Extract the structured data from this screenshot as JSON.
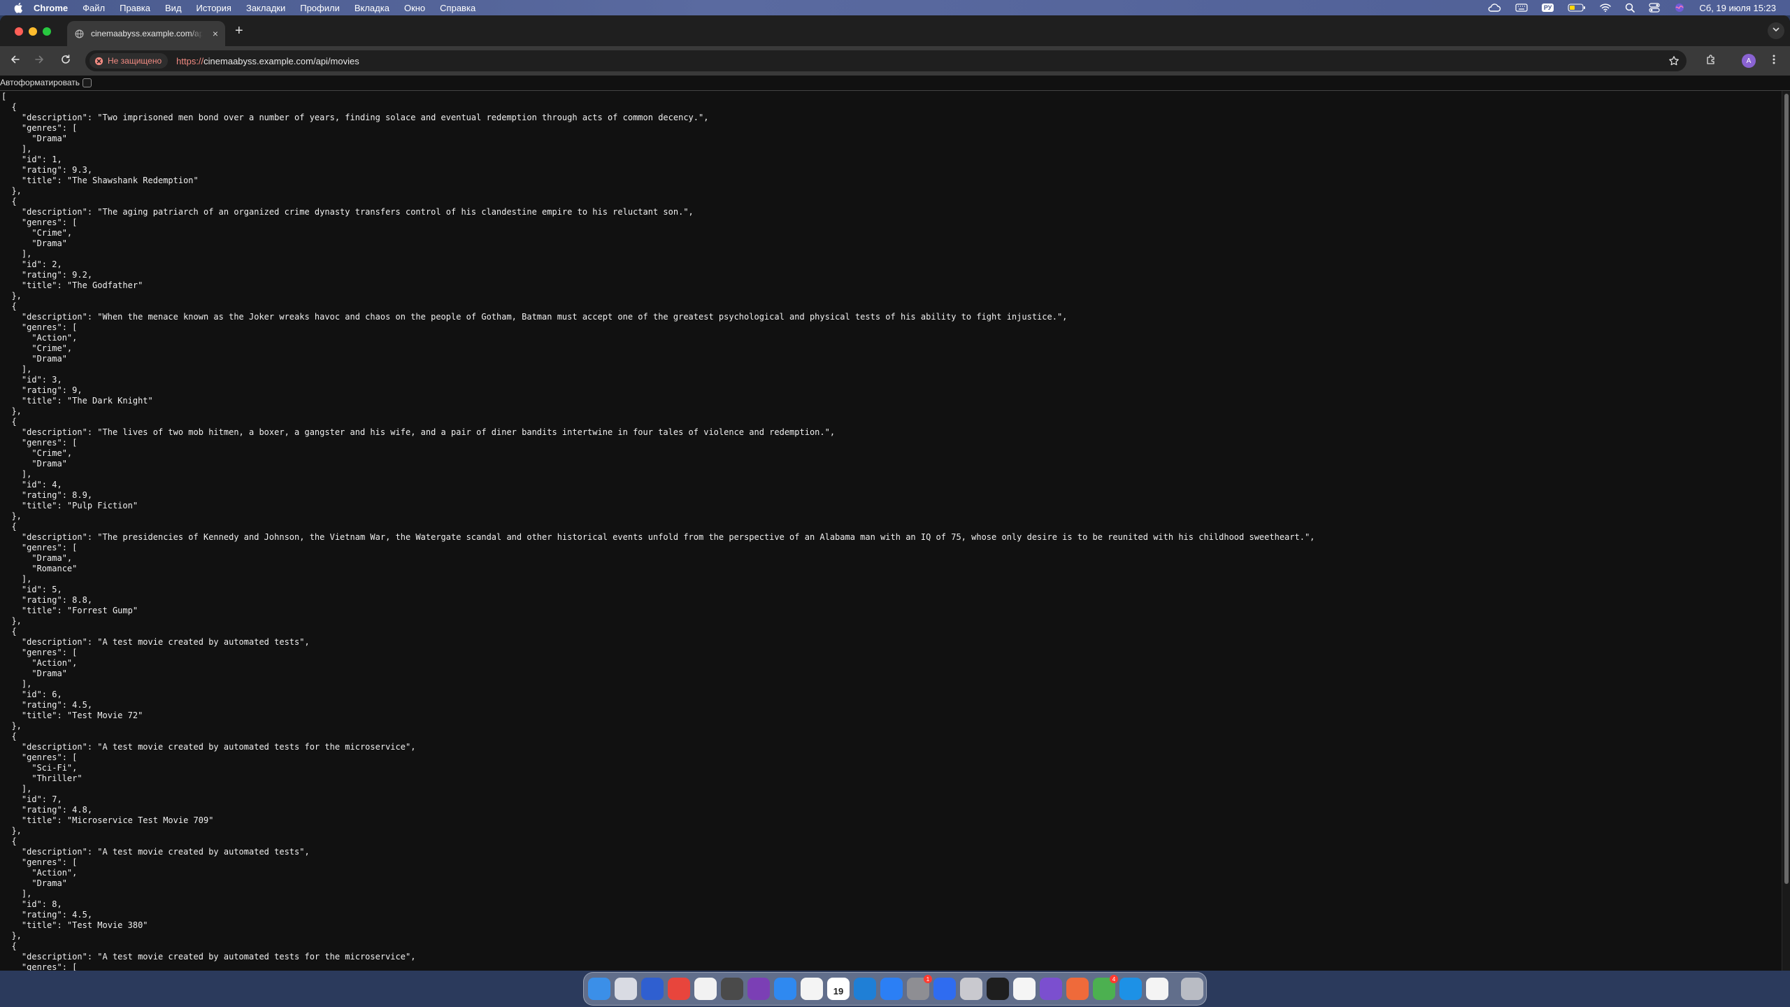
{
  "menubar": {
    "app_name": "Chrome",
    "items": [
      "Файл",
      "Правка",
      "Вид",
      "История",
      "Закладки",
      "Профили",
      "Вкладка",
      "Окно",
      "Справка"
    ],
    "input_language": "РУ",
    "datetime": "Сб, 19 июля  15:23"
  },
  "browser": {
    "tab_title": "cinemaabyss.example.com/api/movies",
    "tab_close_glyph": "×",
    "new_tab_glyph": "+",
    "security_label": "Не защищено",
    "url_scheme": "https://",
    "url_rest": "cinemaabyss.example.com/api/movies",
    "profile_initial": "A"
  },
  "page": {
    "autoformat_label": "Автоформатировать",
    "autoformat_checked": false,
    "movies": [
      {
        "description": "Two imprisoned men bond over a number of years, finding solace and eventual redemption through acts of common decency.",
        "genres": [
          "Drama"
        ],
        "id": 1,
        "rating": 9.3,
        "title": "The Shawshank Redemption"
      },
      {
        "description": "The aging patriarch of an organized crime dynasty transfers control of his clandestine empire to his reluctant son.",
        "genres": [
          "Crime",
          "Drama"
        ],
        "id": 2,
        "rating": 9.2,
        "title": "The Godfather"
      },
      {
        "description": "When the menace known as the Joker wreaks havoc and chaos on the people of Gotham, Batman must accept one of the greatest psychological and physical tests of his ability to fight injustice.",
        "genres": [
          "Action",
          "Crime",
          "Drama"
        ],
        "id": 3,
        "rating": 9,
        "title": "The Dark Knight"
      },
      {
        "description": "The lives of two mob hitmen, a boxer, a gangster and his wife, and a pair of diner bandits intertwine in four tales of violence and redemption.",
        "genres": [
          "Crime",
          "Drama"
        ],
        "id": 4,
        "rating": 8.9,
        "title": "Pulp Fiction"
      },
      {
        "description": "The presidencies of Kennedy and Johnson, the Vietnam War, the Watergate scandal and other historical events unfold from the perspective of an Alabama man with an IQ of 75, whose only desire is to be reunited with his childhood sweetheart.",
        "genres": [
          "Drama",
          "Romance"
        ],
        "id": 5,
        "rating": 8.8,
        "title": "Forrest Gump"
      },
      {
        "description": "A test movie created by automated tests",
        "genres": [
          "Action",
          "Drama"
        ],
        "id": 6,
        "rating": 4.5,
        "title": "Test Movie 72"
      },
      {
        "description": "A test movie created by automated tests for the microservice",
        "genres": [
          "Sci-Fi",
          "Thriller"
        ],
        "id": 7,
        "rating": 4.8,
        "title": "Microservice Test Movie 709"
      },
      {
        "description": "A test movie created by automated tests",
        "genres": [
          "Action",
          "Drama"
        ],
        "id": 8,
        "rating": 4.5,
        "title": "Test Movie 380"
      },
      {
        "description": "A test movie created by automated tests for the microservice",
        "genres": [],
        "partial": true
      }
    ]
  },
  "dock": {
    "apps": [
      {
        "name": "finder",
        "color": "#3b8fe8"
      },
      {
        "name": "launchpad",
        "color": "#d9dbe3"
      },
      {
        "name": "notes-app",
        "color": "#2f5fd0"
      },
      {
        "name": "vpn-app",
        "color": "#e8453c"
      },
      {
        "name": "chrome",
        "color": "#f2f2f2"
      },
      {
        "name": "calculator",
        "color": "#4a4a4a"
      },
      {
        "name": "onenote",
        "color": "#7b3fb5"
      },
      {
        "name": "safari",
        "color": "#2f89f0"
      },
      {
        "name": "photos",
        "color": "#f4f4f4"
      },
      {
        "name": "calendar",
        "color": "#ffffff",
        "label": "19"
      },
      {
        "name": "vscode",
        "color": "#1f7fd6"
      },
      {
        "name": "app-store",
        "color": "#2b7ff5"
      },
      {
        "name": "system-settings",
        "color": "#8e8e93",
        "badge": "1"
      },
      {
        "name": "copilot-app",
        "color": "#2f6cf0"
      },
      {
        "name": "script-editor",
        "color": "#c9c9cf"
      },
      {
        "name": "terminal",
        "color": "#1e1e1e"
      },
      {
        "name": "textedit",
        "color": "#f5f5f5"
      },
      {
        "name": "github-desktop",
        "color": "#7b4fcf"
      },
      {
        "name": "postman",
        "color": "#ef6a3a"
      },
      {
        "name": "messages-app",
        "color": "#4cb050",
        "badge": "4"
      },
      {
        "name": "docker",
        "color": "#1d91e6"
      },
      {
        "name": "freeform",
        "color": "#f4f4f4"
      },
      {
        "name": "trash",
        "color": "#b9bcc4"
      }
    ]
  }
}
